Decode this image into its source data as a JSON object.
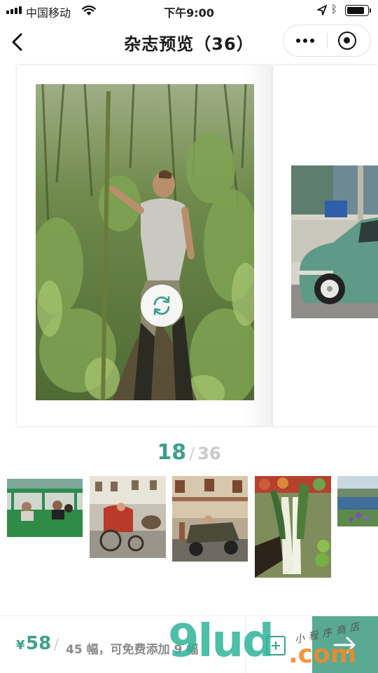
{
  "status_bar": {
    "carrier": "中国移动",
    "time": "下午9:00",
    "icons": [
      "signal-icon",
      "wifi-icon",
      "location-icon",
      "bluetooth-icon",
      "battery-icon"
    ]
  },
  "nav": {
    "title": "杂志预览（36）",
    "icons": [
      "back-icon",
      "more-icon",
      "close-target-icon"
    ]
  },
  "viewer": {
    "left_page": {
      "photo": "man walking through jungle stream",
      "rotate_icon": "rotate-icon"
    },
    "right_page": {
      "photo": "green vintage car on street"
    }
  },
  "counter": {
    "current": "18",
    "separator": "/",
    "total": "36"
  },
  "thumbnails": [
    {
      "name": "green tour cart"
    },
    {
      "name": "horse carriage on street"
    },
    {
      "name": "jeep in colonial town"
    },
    {
      "name": "leeks at market"
    },
    {
      "name": "lake view with flowers"
    }
  ],
  "bottom_bar": {
    "currency": "¥",
    "price": "58",
    "separator": "/",
    "info": "45 幅，可免费添加 9 幅",
    "add_icon": "add-page-icon",
    "next_icon": "arrow-right-icon"
  },
  "watermark": {
    "brand": "9lud",
    "domain": ".com",
    "cn": "小程序商店"
  },
  "colors": {
    "accent": "#3ea08c",
    "next_button": "#5aa992",
    "muted": "#8a8a8a"
  }
}
